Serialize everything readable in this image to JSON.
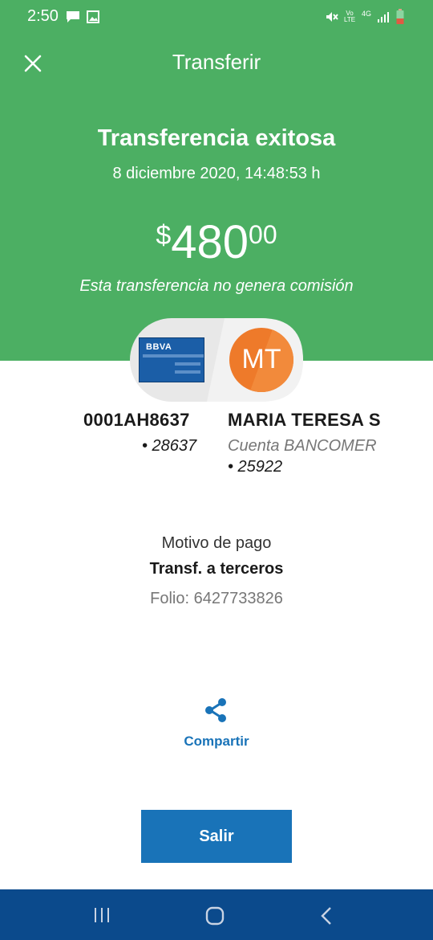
{
  "status_bar": {
    "time": "2:50",
    "network": "4G",
    "volte": "Vo LTE"
  },
  "header": {
    "title": "Transferir"
  },
  "result": {
    "heading": "Transferencia exitosa",
    "datetime": "8 diciembre 2020, 14:48:53 h",
    "amount": {
      "currency": "$",
      "integer": "480",
      "decimals": "00"
    },
    "fee_note": "Esta transferencia no genera comisión"
  },
  "origin": {
    "bank_logo_text": "BBVA",
    "account": "0001AH8637",
    "masked": "• 28637"
  },
  "destination": {
    "avatar_initials": "MT",
    "name": "MARIA TERESA S",
    "bank": "Cuenta BANCOMER",
    "masked": "• 25922"
  },
  "details": {
    "reason_label": "Motivo de pago",
    "reason_value": "Transf. a terceros",
    "folio": "Folio: 6427733826"
  },
  "actions": {
    "share_label": "Compartir",
    "exit_label": "Salir"
  },
  "colors": {
    "header_bg": "#4caf63",
    "primary": "#1973b8",
    "nav_bg": "#0b4a8c",
    "avatar": "#ee7a2a"
  }
}
